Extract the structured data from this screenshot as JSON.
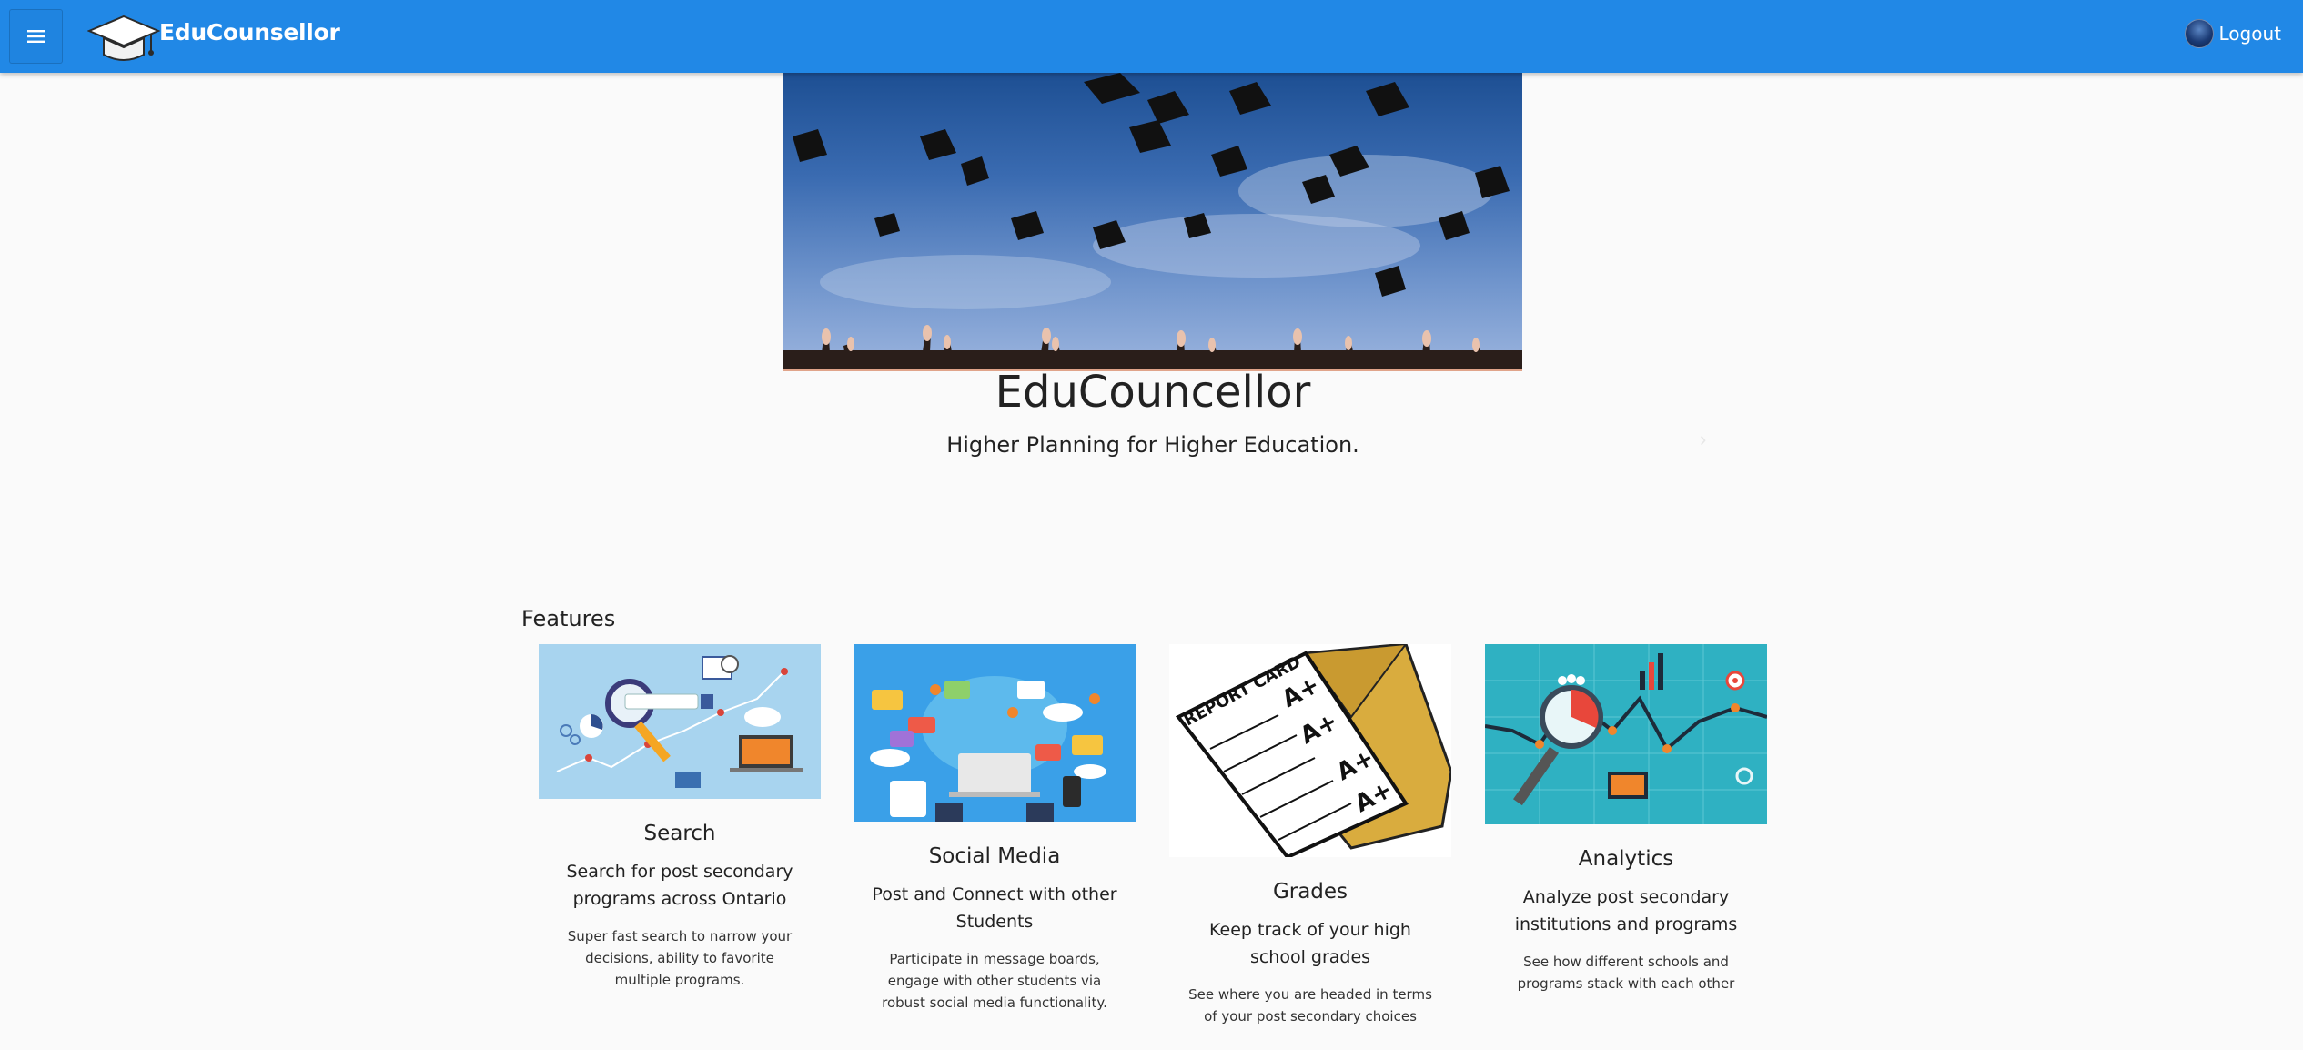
{
  "appbar": {
    "brand": "EduCounsellor",
    "logout_label": "Logout",
    "color": "#2188e6",
    "icons": [
      "menu-icon",
      "graduation-cap-icon",
      "avatar"
    ]
  },
  "hero": {
    "title": "EduCouncellor",
    "subtitle": "Higher Planning for Higher Education."
  },
  "features": {
    "heading": "Features",
    "cards": [
      {
        "title": "Search",
        "subtitle": "Search for post secondary programs across Ontario",
        "description": "Super fast search to narrow your decisions, ability to favorite multiple programs."
      },
      {
        "title": "Social Media",
        "subtitle": "Post and Connect with other Students",
        "description": "Participate in message boards, engage with other students via robust social media functionality."
      },
      {
        "title": "Grades",
        "subtitle": "Keep track of your high school grades",
        "description": "See where you are headed in terms of your post secondary choices"
      },
      {
        "title": "Analytics",
        "subtitle": "Analyze post secondary institutions and programs",
        "description": "See how different schools and programs stack with each other"
      }
    ]
  }
}
